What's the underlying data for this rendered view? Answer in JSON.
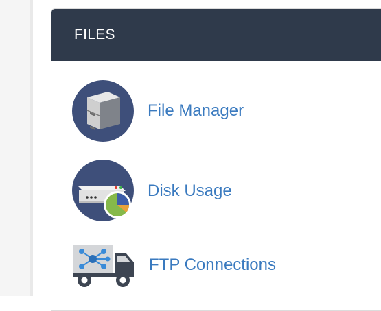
{
  "panel": {
    "title": "FILES"
  },
  "items": [
    {
      "label": "File Manager",
      "icon": "file-cabinet-icon"
    },
    {
      "label": "Disk Usage",
      "icon": "disk-usage-icon"
    },
    {
      "label": "FTP Connections",
      "icon": "ftp-truck-icon"
    }
  ],
  "colors": {
    "header_bg": "#2f3a4b",
    "link": "#3a7abf",
    "icon_circle": "#3e4f7a"
  }
}
